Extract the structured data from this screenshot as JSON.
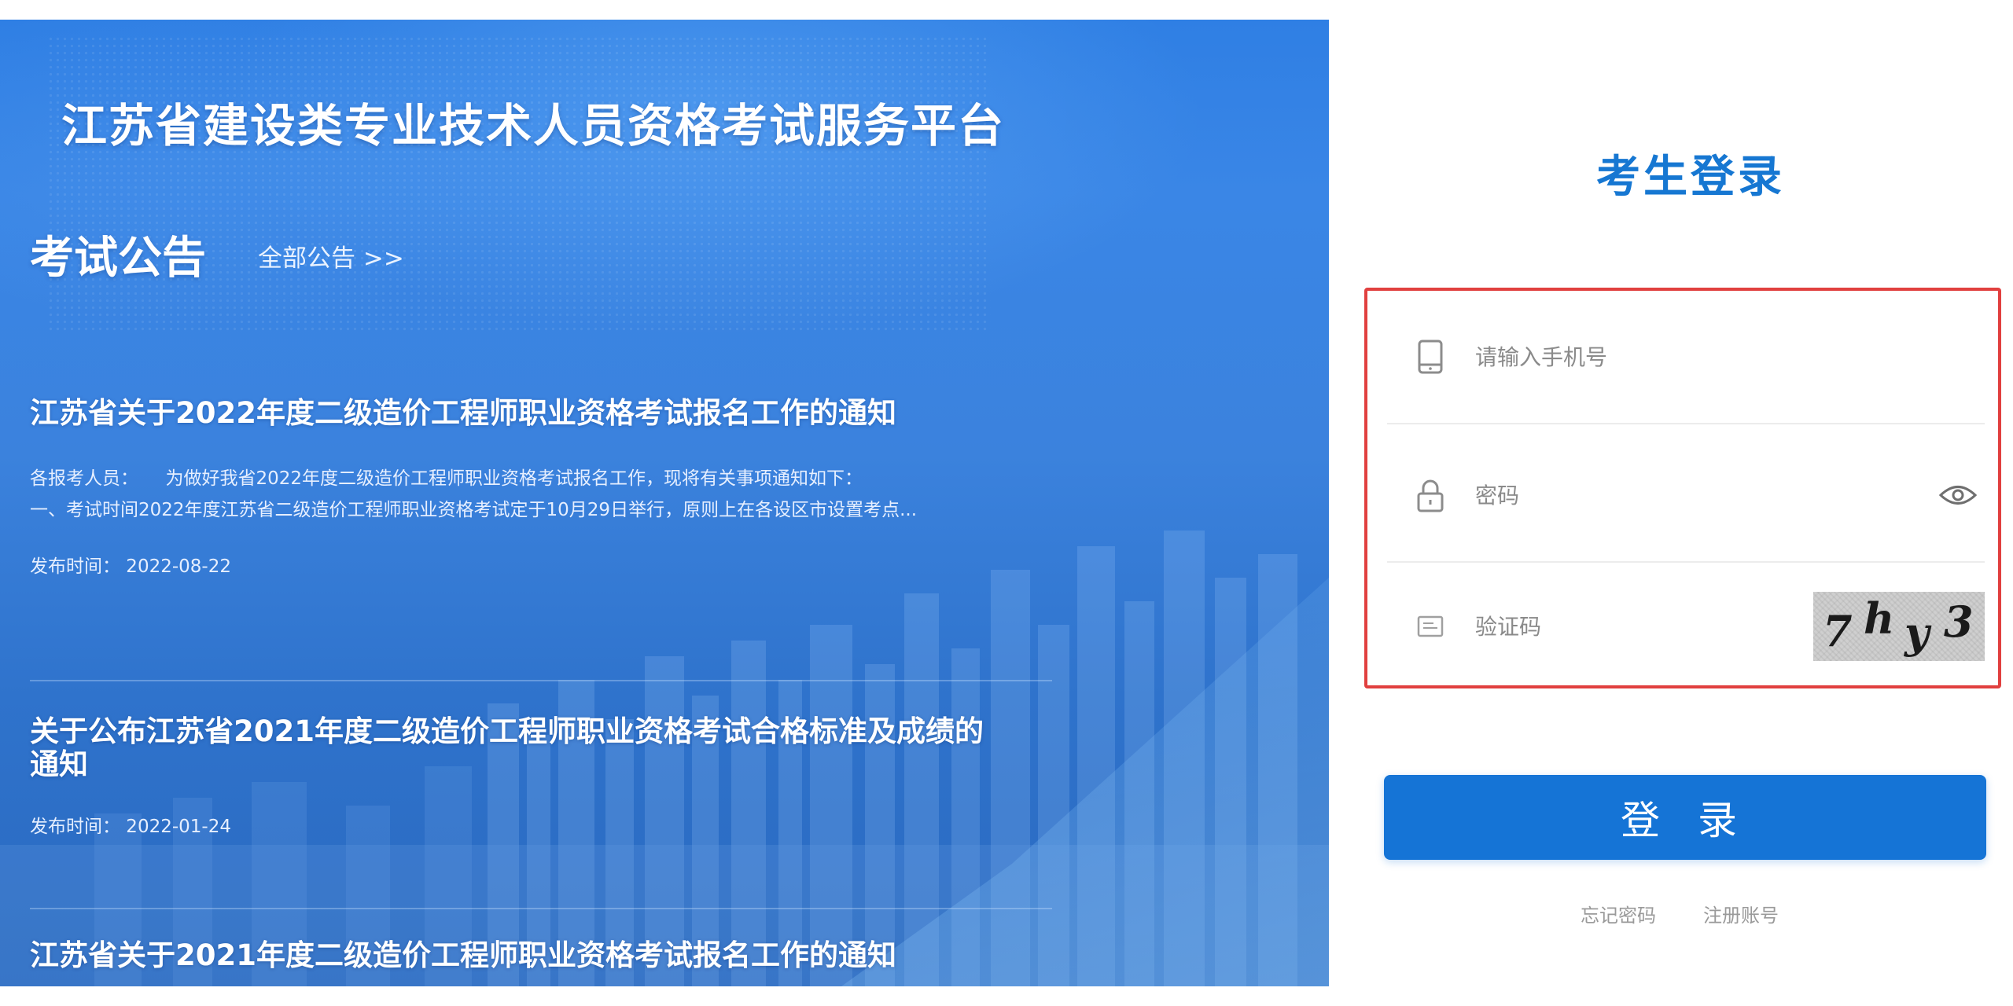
{
  "banner": {
    "platform_title": "江苏省建设类专业技术人员资格考试服务平台",
    "notice_heading": "考试公告",
    "all_notices_link": "全部公告 >>",
    "news": [
      {
        "title": "江苏省关于2022年度二级造价工程师职业资格考试报名工作的通知",
        "summary_line1": "各报考人员：　　为做好我省2022年度二级造价工程师职业资格考试报名工作，现将有关事项通知如下：",
        "summary_line2": "一、考试时间2022年度江苏省二级造价工程师职业资格考试定于10月29日举行，原则上在各设区市设置考点...",
        "date": "发布时间： 2022-08-22"
      },
      {
        "title_line1": "关于公布江苏省2021年度二级造价工程师职业资格考试合格标准及成绩的",
        "title_line2": "通知",
        "date": "发布时间： 2022-01-24"
      },
      {
        "title": "江苏省关于2021年度二级造价工程师职业资格考试报名工作的通知"
      }
    ]
  },
  "login": {
    "title": "考生登录",
    "phone_placeholder": "请输入手机号",
    "password_placeholder": "密码",
    "captcha_placeholder": "验证码",
    "captcha_chars": [
      "7",
      "h",
      "y",
      "3"
    ],
    "submit_label": "登 录",
    "forgot_password": "忘记密码",
    "register": "注册账号"
  },
  "icons": {
    "phone": "phone-icon",
    "lock": "lock-icon",
    "eye": "eye-icon",
    "captcha": "captcha-icon"
  },
  "colors": {
    "accent": "#1574d6",
    "highlight_border": "#e1403f",
    "banner_blue": "#3a86e6"
  }
}
